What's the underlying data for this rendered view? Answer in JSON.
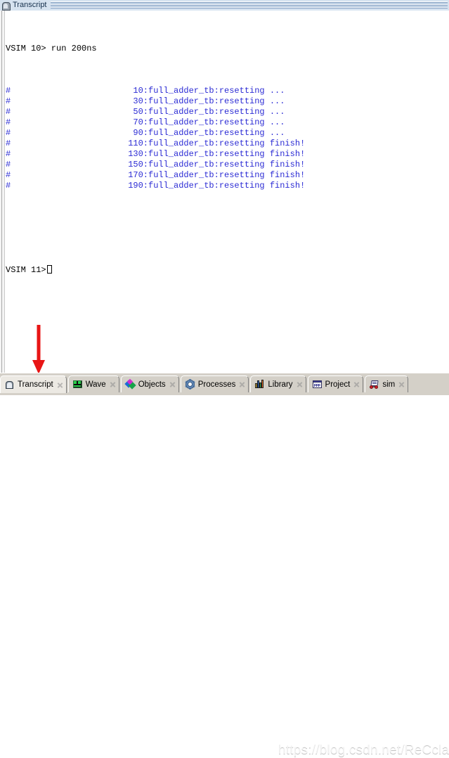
{
  "window": {
    "title": "Transcript",
    "title_icon": "transcript-window-icon"
  },
  "console": {
    "command_line": "VSIM 10> run 200ns",
    "hash_marker": "#",
    "entries": [
      {
        "time": "10:",
        "message": "full_adder_tb:resetting ..."
      },
      {
        "time": "30:",
        "message": "full_adder_tb:resetting ..."
      },
      {
        "time": "50:",
        "message": "full_adder_tb:resetting ..."
      },
      {
        "time": "70:",
        "message": "full_adder_tb:resetting ..."
      },
      {
        "time": "90:",
        "message": "full_adder_tb:resetting ..."
      },
      {
        "time": "110:",
        "message": "full_adder_tb:resetting finish!"
      },
      {
        "time": "130:",
        "message": "full_adder_tb:resetting finish!"
      },
      {
        "time": "150:",
        "message": "full_adder_tb:resetting finish!"
      },
      {
        "time": "170:",
        "message": "full_adder_tb:resetting finish!"
      },
      {
        "time": "190:",
        "message": "full_adder_tb:resetting finish!"
      }
    ],
    "prompt": "VSIM 11>",
    "text_color": "#2b2bd4",
    "command_color": "#000000"
  },
  "annotation": {
    "arrow_color": "#e81515",
    "arrow_points_to": "Transcript"
  },
  "tabs": [
    {
      "label": "Transcript",
      "icon": "transcript-icon",
      "active": true
    },
    {
      "label": "Wave",
      "icon": "wave-icon",
      "active": false
    },
    {
      "label": "Objects",
      "icon": "objects-icon",
      "active": false
    },
    {
      "label": "Processes",
      "icon": "processes-icon",
      "active": false
    },
    {
      "label": "Library",
      "icon": "library-icon",
      "active": false
    },
    {
      "label": "Project",
      "icon": "project-icon",
      "active": false
    },
    {
      "label": "sim",
      "icon": "sim-icon",
      "active": false
    }
  ],
  "watermark": {
    "text": "https://blog.csdn.net/ReCclay"
  }
}
